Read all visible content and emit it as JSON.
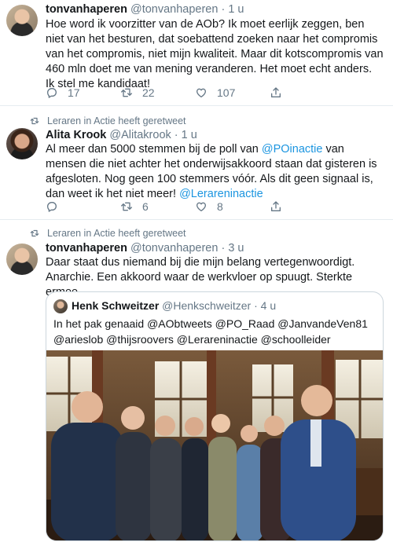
{
  "tweets": [
    {
      "display_name": "tonvanhaperen",
      "handle": "@tonvanhaperen",
      "time": "1 u",
      "text": "Hoe word ik voorzitter van de AOb? Ik moet eerlijk zeggen, ben niet van het besturen, dat soebattend zoeken naar het compromis van het compromis, niet mijn kwaliteit. Maar dit kotscompromis van 460 mln doet me van mening veranderen. Het moet echt anders. Ik stel me kandidaat!",
      "replies": "17",
      "retweets": "22",
      "likes": "107"
    },
    {
      "retweeted_by": "Leraren in Actie heeft geretweet",
      "display_name": "Alita Krook",
      "handle": "@Alitakrook",
      "time": "1 u",
      "text_parts": [
        "Al meer dan 5000 stemmen bij de poll van ",
        "@POinactie",
        " van mensen die niet achter het onderwijsakkoord staan dat gisteren is afgesloten. Nog geen 100 stemmers vóór. Als dit geen signaal is, dan weet ik het niet meer! ",
        "@Lerareninactie"
      ],
      "replies": "",
      "retweets": "6",
      "likes": "8"
    },
    {
      "retweeted_by": "Leraren in Actie heeft geretweet",
      "display_name": "tonvanhaperen",
      "handle": "@tonvanhaperen",
      "time": "3 u",
      "text": "Daar staat dus niemand bij die mijn belang vertegenwoordigt. Anarchie. Een akkoord waar de werkvloer op spuugt. Sterkte ermee.",
      "quote": {
        "display_name": "Henk Schweitzer",
        "handle": "@Henkschweitzer",
        "time": "4 u",
        "text": "In het pak genaaid @AObtweets @PO_Raad @JanvandeVen81 @arieslob @thijsroovers @Lerareninactie @schoolleider"
      }
    }
  ],
  "dot": "·",
  "colors": {
    "link": "#1b95e0",
    "muted": "#657786",
    "text": "#14171a",
    "divider": "#e6ecf0"
  },
  "icons": [
    "reply-icon",
    "retweet-icon",
    "like-icon",
    "share-icon",
    "retweet-small-icon"
  ]
}
